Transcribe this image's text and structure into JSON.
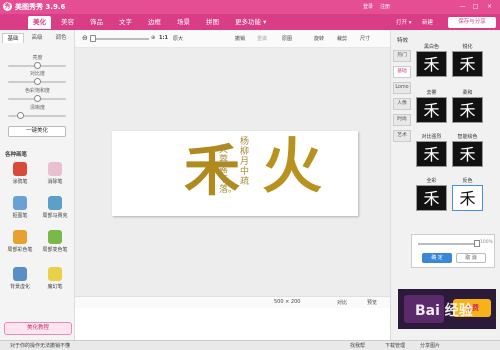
{
  "app": {
    "title": "美图秀秀 3.9.6",
    "logo": "秀"
  },
  "titlebar": {
    "login": "登录",
    "register": "注册",
    "min": "—",
    "max": "□",
    "close": "×"
  },
  "nav": {
    "tabs": [
      {
        "label": "美化",
        "active": true
      },
      {
        "label": "美容"
      },
      {
        "label": "饰品"
      },
      {
        "label": "文字"
      },
      {
        "label": "边框"
      },
      {
        "label": "场景"
      },
      {
        "label": "拼图"
      },
      {
        "label": "更多功能 ▾"
      }
    ],
    "open": "打开 ▾",
    "new": "新建",
    "save": "保存与分享"
  },
  "left_panel": {
    "tabs": [
      "基础",
      "高级",
      "调色"
    ],
    "active_tab": "基础",
    "sliders": [
      {
        "label": "亮度",
        "value": 0.5
      },
      {
        "label": "对比度",
        "value": 0.5
      },
      {
        "label": "色彩饱和度",
        "value": 0.5
      },
      {
        "label": "清晰度",
        "value": 0.2
      }
    ],
    "one_click": "一键美化",
    "section_title": "各种画笔",
    "tools": [
      {
        "label": "涂鸦笔",
        "color": "#d84a3a"
      },
      {
        "label": "消除笔",
        "color": "#e8c0d0"
      },
      {
        "label": "抠图笔",
        "color": "#6aa0d8"
      },
      {
        "label": "局部马赛克",
        "color": "#5aa0c8"
      },
      {
        "label": "局部彩色笔",
        "color": "#e8a030"
      },
      {
        "label": "局部变色笔",
        "color": "#7ab848"
      },
      {
        "label": "背景虚化",
        "color": "#5a8ec8"
      },
      {
        "label": "魔幻笔",
        "color": "#e8d048"
      }
    ],
    "tutorial": "美化教程"
  },
  "toolbar": {
    "zoom_ratio": "1:1",
    "fullsize": "原大",
    "items": [
      "撤销",
      "重做",
      "原图",
      "旋转",
      "裁剪",
      "尺寸"
    ]
  },
  "artwork": {
    "char_left": "禾",
    "char_right": "火",
    "poem_col1": "芙蓉露下落。",
    "poem_col2": "杨柳月中疏"
  },
  "statusbar": {
    "dims": "500 × 200",
    "compare": "对比",
    "preview": "预览"
  },
  "right_panel": {
    "title": "特效",
    "categories": [
      "热门",
      "基础",
      "Lomo",
      "人像",
      "时尚",
      "艺术"
    ],
    "active_category": "基础",
    "effects": [
      {
        "label": "黑白色"
      },
      {
        "label": "锐化"
      },
      {
        "label": "去雾"
      },
      {
        "label": "柔和"
      },
      {
        "label": "对比强烈"
      },
      {
        "label": "智能绘色"
      },
      {
        "label": "全彩"
      },
      {
        "label": "反色",
        "selected": true
      }
    ],
    "effect_name": "反色",
    "strength": "100%",
    "strength_value": 1.0,
    "ok": "确 定",
    "cancel": "取 消",
    "ad_text": "免费"
  },
  "bottombar": {
    "tip": "对于你的操作无法撤销不懂",
    "help": "找我帮",
    "download": "下载管理",
    "share": "分享图片"
  },
  "watermark": "Bai 经验"
}
